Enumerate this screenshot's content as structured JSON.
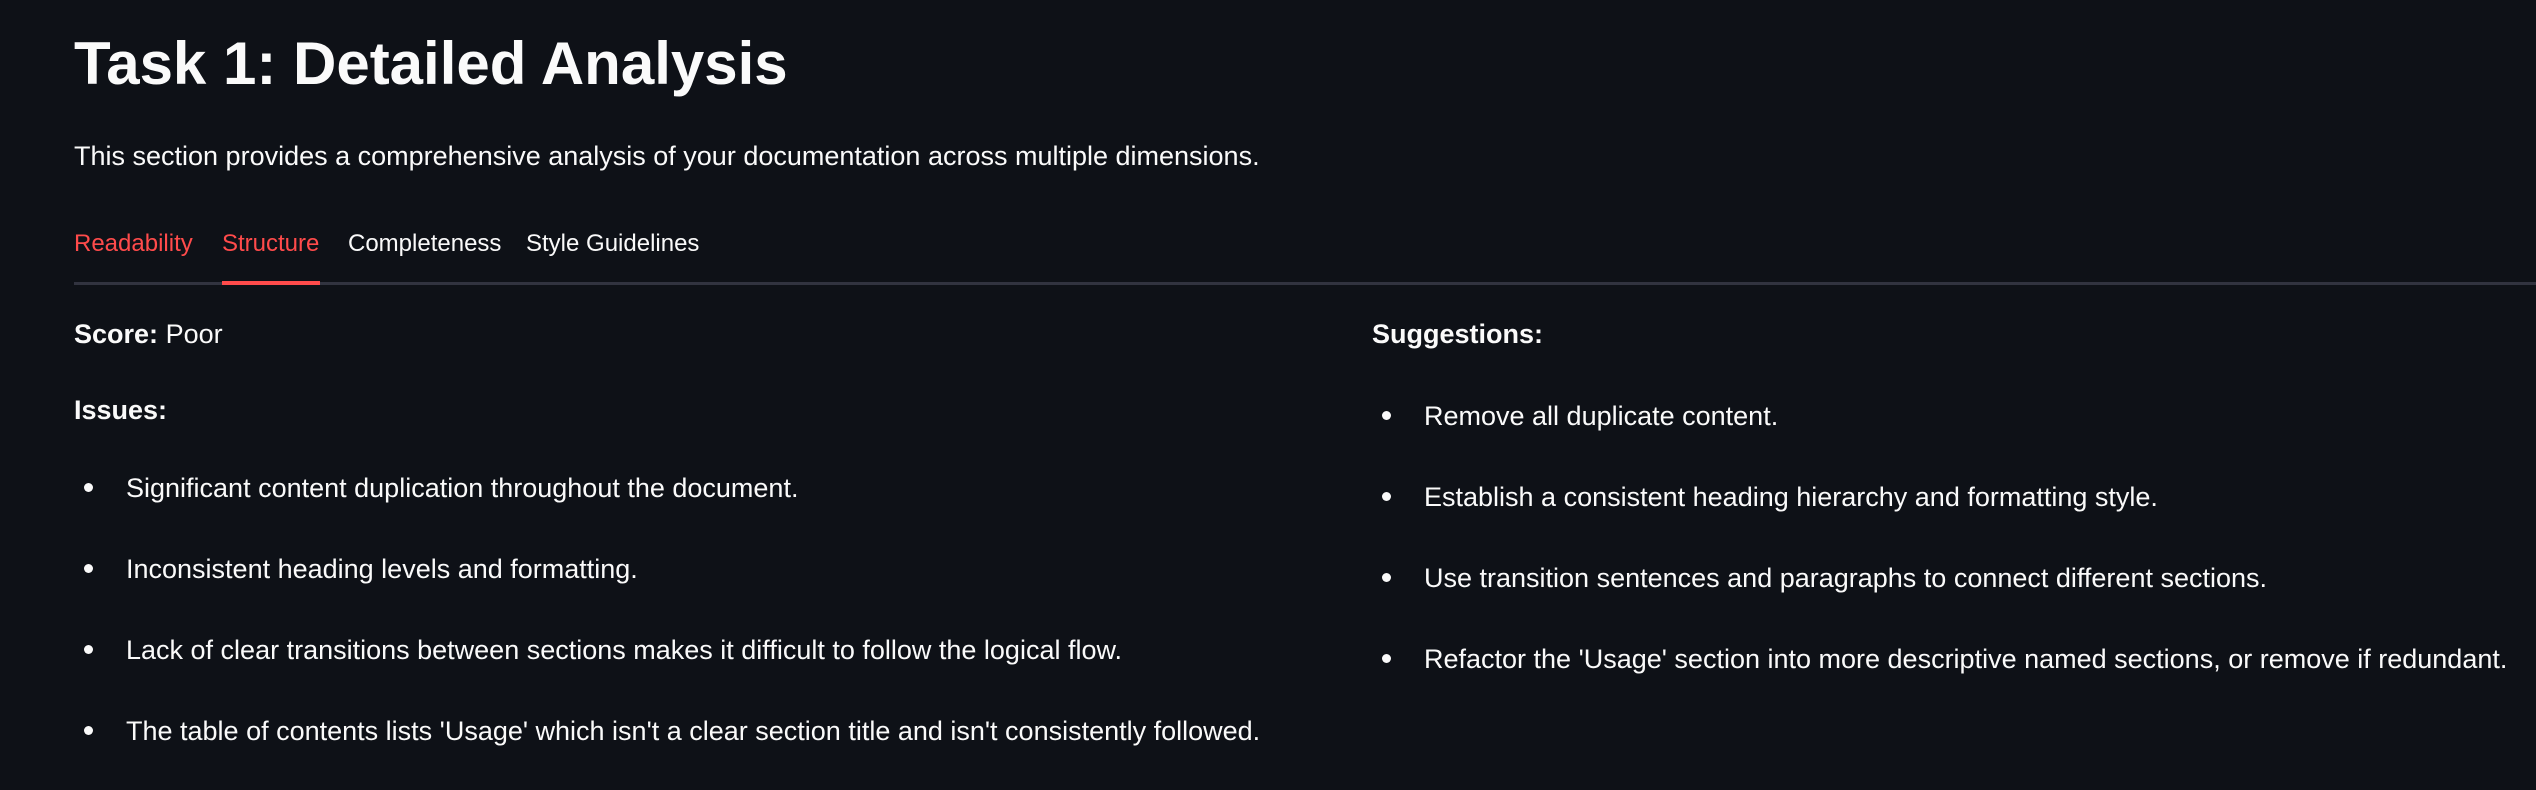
{
  "page": {
    "title": "Task 1: Detailed Analysis",
    "intro": "This section provides a comprehensive analysis of your documentation across multiple dimensions."
  },
  "tabs": [
    {
      "label": "Readability"
    },
    {
      "label": "Structure",
      "active": true
    },
    {
      "label": "Completeness"
    },
    {
      "label": "Style Guidelines"
    }
  ],
  "score": {
    "label": "Score:",
    "value": "Poor"
  },
  "issues": {
    "label": "Issues:",
    "items": [
      "Significant content duplication throughout the document.",
      "Inconsistent heading levels and formatting.",
      "Lack of clear transitions between sections makes it difficult to follow the logical flow.",
      "The table of contents lists 'Usage' which isn't a clear section title and isn't consistently followed."
    ]
  },
  "suggestions": {
    "label": "Suggestions:",
    "items": [
      "Remove all duplicate content.",
      "Establish a consistent heading hierarchy and formatting style.",
      "Use transition sentences and paragraphs to connect different sections.",
      "Refactor the 'Usage' section into more descriptive named sections, or remove if redundant."
    ]
  },
  "colors": {
    "background": "#0e1117",
    "text": "#fafafa",
    "accent": "#ff4b4b",
    "tab_divider": "#31333f"
  }
}
